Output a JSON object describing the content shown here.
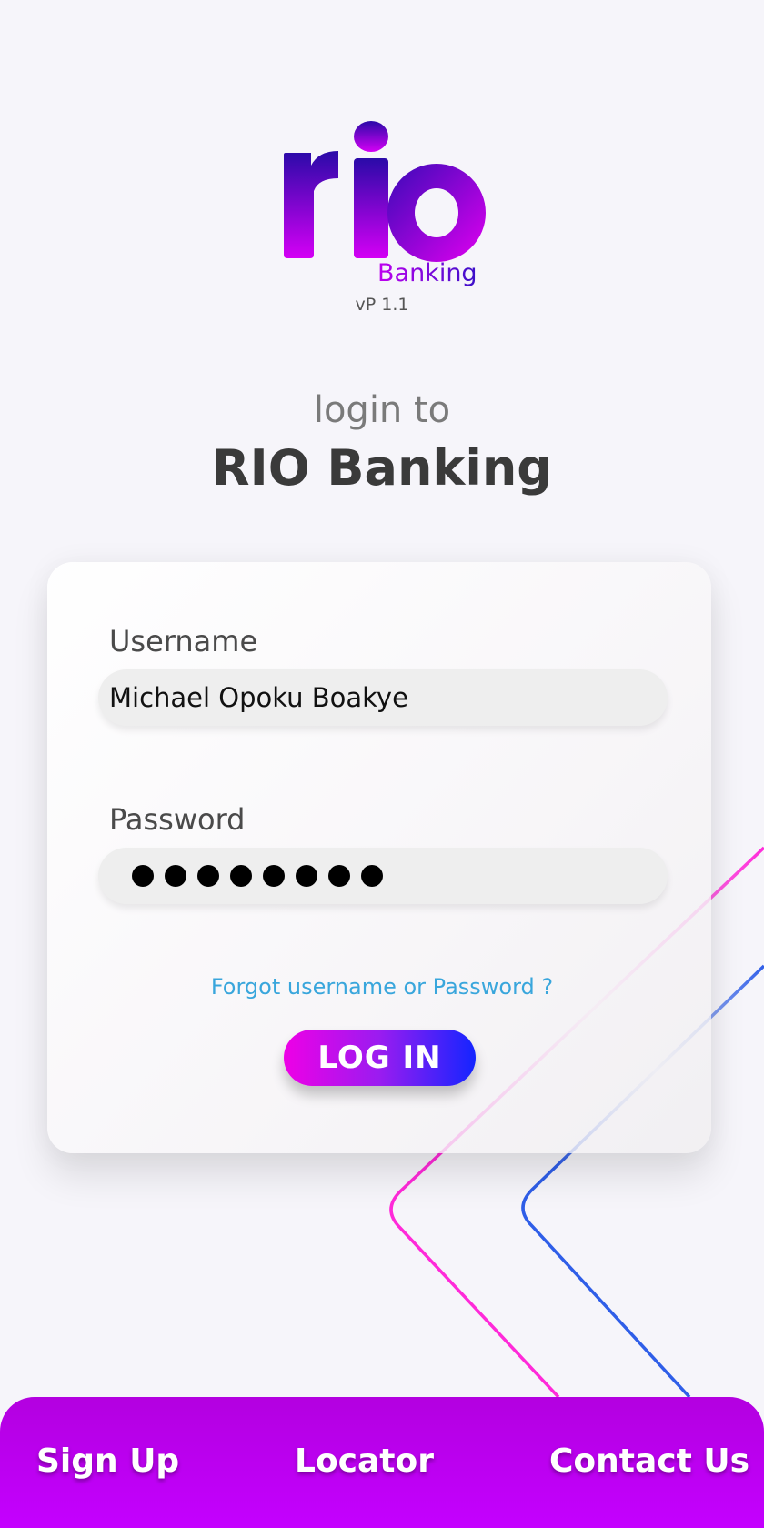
{
  "brand": {
    "logo_text": "rio",
    "logo_sub": "Banking",
    "version": "vP 1.1"
  },
  "heading": {
    "intro": "login to",
    "app_name": "RIO Banking"
  },
  "form": {
    "username_label": "Username",
    "username_value": "Michael Opoku Boakye",
    "password_label": "Password",
    "password_masked_length": 8,
    "forgot_link": "Forgot username or Password ?",
    "login_button": "LOG IN"
  },
  "bottom_nav": {
    "items": [
      {
        "label": "Sign Up"
      },
      {
        "label": "Locator"
      },
      {
        "label": "Contact Us"
      }
    ]
  },
  "colors": {
    "accent_purple": "#c400ff",
    "accent_magenta": "#ff2ad9",
    "accent_blue": "#2f5ee8",
    "link_blue": "#39a6dc",
    "background": "#f6f5fa"
  }
}
